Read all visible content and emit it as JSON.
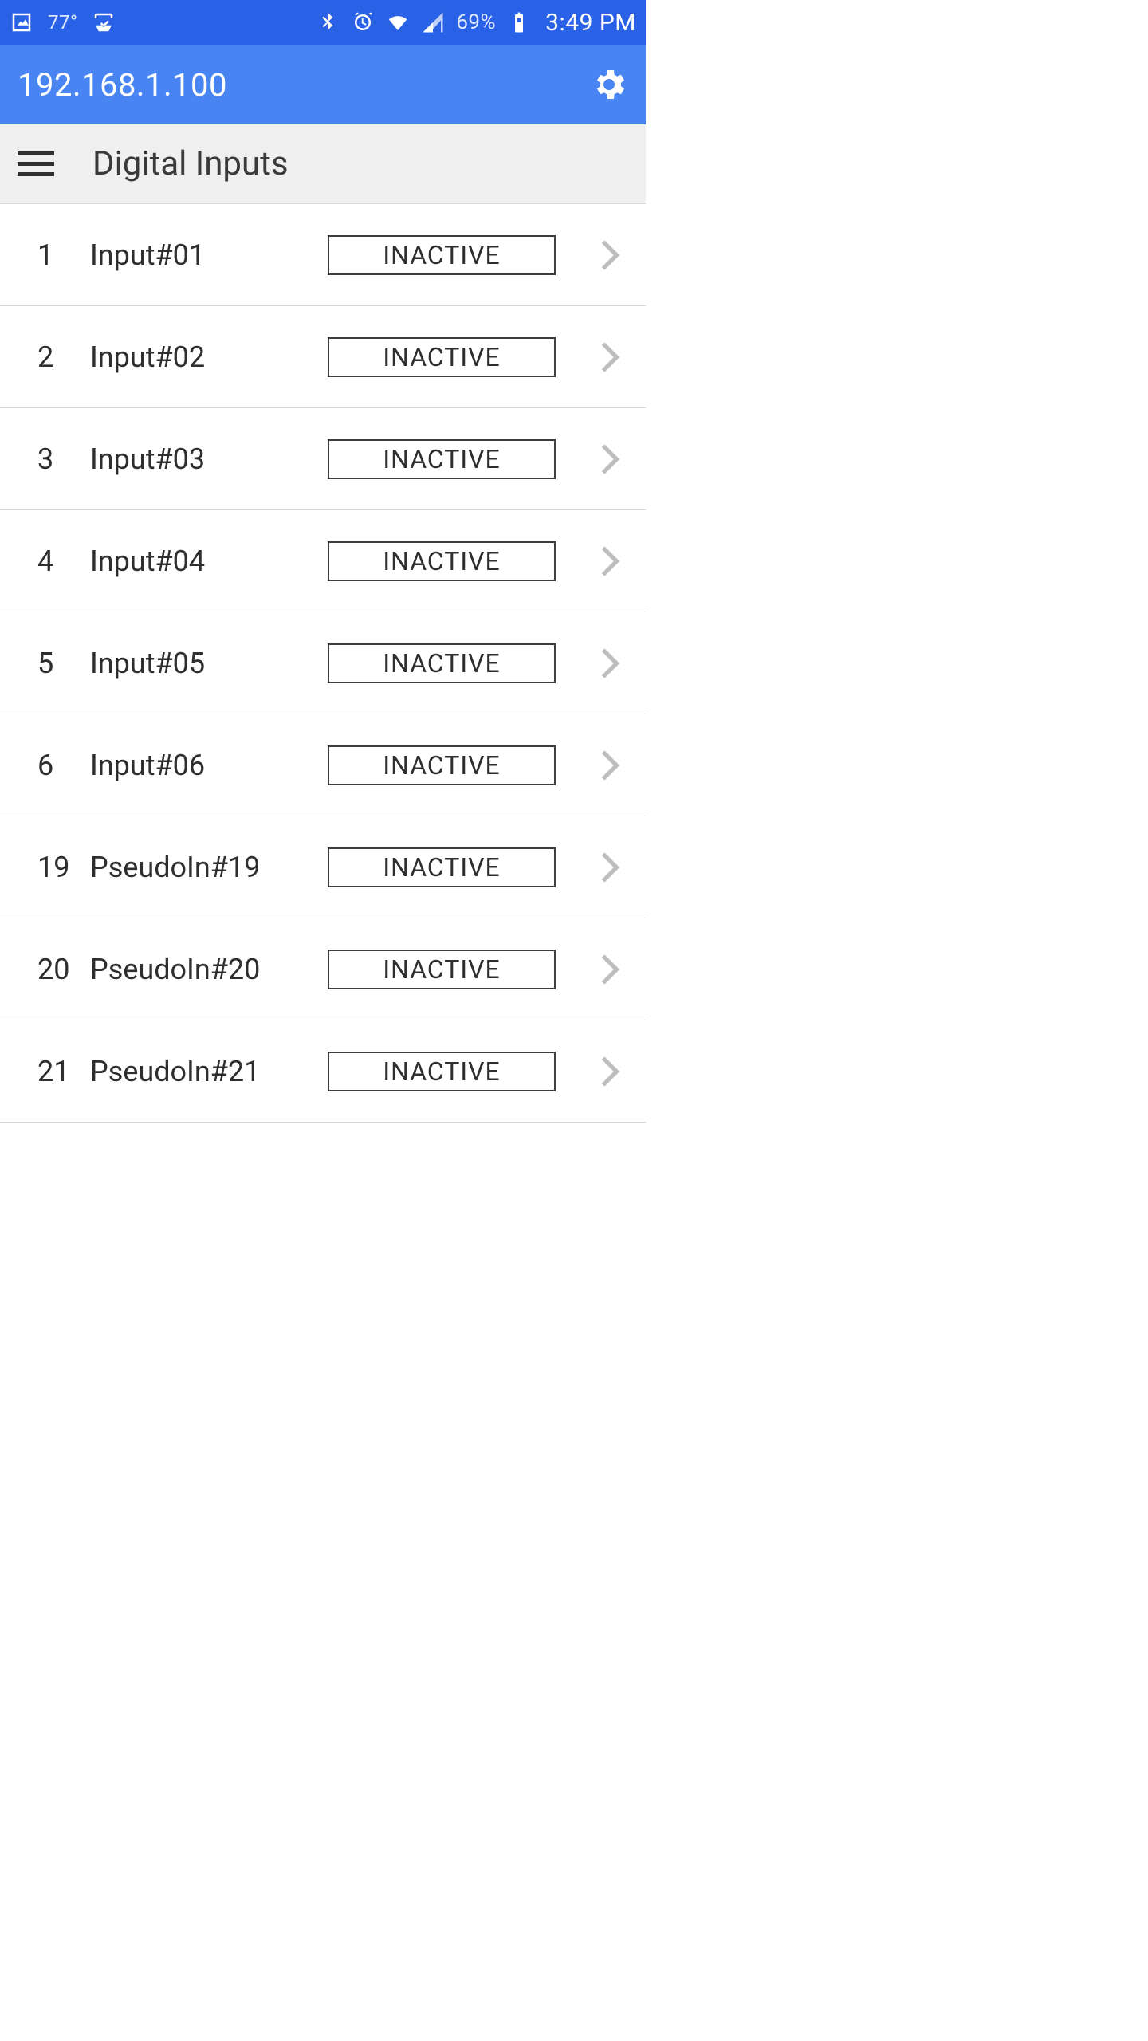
{
  "status": {
    "temp": "77°",
    "battery": "69%",
    "time": "3:49 PM"
  },
  "app": {
    "title": "192.168.1.100"
  },
  "section": {
    "title": "Digital Inputs"
  },
  "rows": [
    {
      "num": "1",
      "name": "Input#01",
      "status": "INACTIVE"
    },
    {
      "num": "2",
      "name": "Input#02",
      "status": "INACTIVE"
    },
    {
      "num": "3",
      "name": "Input#03",
      "status": "INACTIVE"
    },
    {
      "num": "4",
      "name": "Input#04",
      "status": "INACTIVE"
    },
    {
      "num": "5",
      "name": "Input#05",
      "status": "INACTIVE"
    },
    {
      "num": "6",
      "name": "Input#06",
      "status": "INACTIVE"
    },
    {
      "num": "19",
      "name": "PseudoIn#19",
      "status": "INACTIVE"
    },
    {
      "num": "20",
      "name": "PseudoIn#20",
      "status": "INACTIVE"
    },
    {
      "num": "21",
      "name": "PseudoIn#21",
      "status": "INACTIVE"
    }
  ]
}
